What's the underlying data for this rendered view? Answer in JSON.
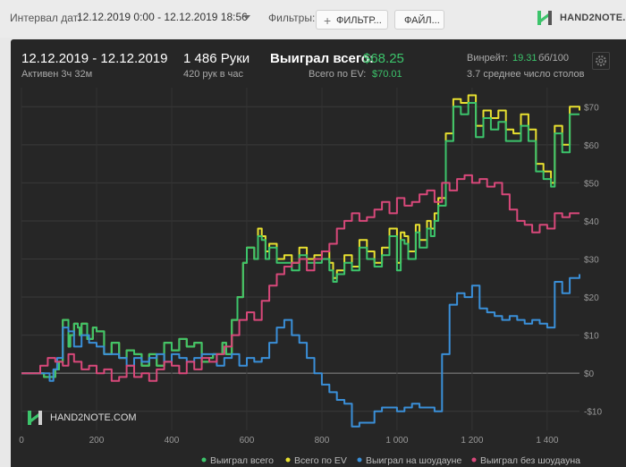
{
  "filters_bar": {
    "interval_label": "Интервал дат:",
    "date_range": "12.12.2019 0:00 - 12.12.2019 18:56",
    "filters_label": "Фильтры:",
    "filter_button": "ФИЛЬТР...",
    "file_button": "ФАЙЛ..."
  },
  "logo": {
    "text": "HAND2NOTE.COM"
  },
  "summary": {
    "date_range": "12.12.2019 - 12.12.2019",
    "active_time": "Активен 3ч 32м",
    "hands": "1 486 Руки",
    "hands_per_hour": "420 рук в час",
    "won_total_label": "Выиграл всего:",
    "won_total_value": "$68.25",
    "ev_total_label": "Всего по EV:",
    "ev_total_value": "$70.01",
    "winrate_label": "Винрейт:",
    "winrate_value": "19.31",
    "winrate_unit": "бб/100",
    "avg_tables": "3.7 среднее число столов"
  },
  "watermark": "HAND2NOTE.COM",
  "chart_data": {
    "type": "line",
    "xlim": [
      0,
      1486
    ],
    "ylim": [
      -15,
      75
    ],
    "x_ticks": [
      0,
      200,
      400,
      600,
      800,
      1000,
      1200,
      1400
    ],
    "x_tick_labels": [
      "0",
      "200",
      "400",
      "600",
      "800",
      "1 000",
      "1 200",
      "1 400"
    ],
    "y_ticks": [
      -10,
      0,
      10,
      20,
      30,
      40,
      50,
      60,
      70
    ],
    "y_tick_labels": [
      "-$10",
      "$0",
      "$10",
      "$20",
      "$30",
      "$40",
      "$50",
      "$60",
      "$70"
    ],
    "grid": true,
    "legend_position": "bottom",
    "series": [
      {
        "name": "Всего по EV",
        "color": "#e8e030",
        "x": [
          0,
          30,
          60,
          90,
          100,
          110,
          125,
          130,
          140,
          150,
          155,
          160,
          175,
          190,
          200,
          220,
          240,
          260,
          280,
          300,
          320,
          340,
          360,
          380,
          400,
          420,
          440,
          460,
          480,
          500,
          510,
          520,
          535,
          545,
          560,
          575,
          590,
          600,
          620,
          630,
          640,
          650,
          660,
          680,
          700,
          720,
          740,
          760,
          780,
          800,
          820,
          830,
          840,
          860,
          880,
          900,
          920,
          940,
          960,
          980,
          1000,
          1010,
          1020,
          1030,
          1050,
          1060,
          1080,
          1090,
          1100,
          1110,
          1130,
          1150,
          1170,
          1190,
          1210,
          1230,
          1250,
          1270,
          1290,
          1310,
          1330,
          1350,
          1370,
          1390,
          1410,
          1420,
          1440,
          1460,
          1486
        ],
        "values": [
          0,
          0,
          -1,
          1,
          3,
          14,
          7,
          10,
          13,
          12,
          10,
          13,
          9,
          12,
          11,
          5,
          8,
          4,
          6,
          5,
          2,
          5,
          2,
          8,
          6,
          9,
          7,
          8,
          3,
          4,
          5,
          5,
          8,
          5,
          14,
          20,
          29,
          33,
          30,
          38,
          36,
          32,
          34,
          30,
          31,
          29,
          33,
          30,
          31,
          32,
          29,
          25,
          27,
          31,
          28,
          35,
          32,
          29,
          33,
          38,
          29,
          37,
          36,
          32,
          39,
          35,
          40,
          38,
          42,
          46,
          63,
          72,
          71,
          73,
          65,
          69,
          67,
          69,
          64,
          63,
          68,
          64,
          55,
          53,
          50,
          65,
          60,
          70,
          69
        ]
      },
      {
        "name": "Выиграл всего",
        "color": "#3cc46b",
        "x": [
          0,
          30,
          60,
          90,
          100,
          110,
          125,
          130,
          140,
          150,
          155,
          160,
          175,
          190,
          200,
          220,
          240,
          260,
          280,
          300,
          320,
          340,
          360,
          380,
          400,
          420,
          440,
          460,
          480,
          500,
          510,
          520,
          535,
          545,
          560,
          575,
          590,
          600,
          620,
          630,
          640,
          650,
          660,
          680,
          700,
          720,
          740,
          760,
          780,
          800,
          820,
          830,
          840,
          860,
          880,
          900,
          920,
          940,
          960,
          980,
          1000,
          1010,
          1020,
          1030,
          1050,
          1060,
          1080,
          1090,
          1100,
          1110,
          1130,
          1150,
          1170,
          1190,
          1210,
          1230,
          1250,
          1270,
          1290,
          1310,
          1330,
          1350,
          1370,
          1390,
          1410,
          1420,
          1440,
          1460,
          1486
        ],
        "values": [
          0,
          0,
          -1,
          1,
          3,
          14,
          7,
          10,
          13,
          12,
          10,
          13,
          9,
          12,
          11,
          5,
          8,
          4,
          6,
          5,
          2,
          5,
          2,
          8,
          6,
          9,
          7,
          8,
          3,
          4,
          5,
          5,
          8,
          5,
          14,
          20,
          29,
          33,
          30,
          36,
          35,
          30,
          33,
          29,
          29,
          27,
          31,
          29,
          29,
          30,
          27,
          24,
          26,
          29,
          27,
          33,
          30,
          28,
          31,
          36,
          27,
          35,
          34,
          30,
          37,
          33,
          38,
          36,
          40,
          44,
          61,
          70,
          68,
          71,
          62,
          67,
          64,
          66,
          61,
          61,
          65,
          61,
          53,
          51,
          49,
          63,
          58,
          68,
          68
        ]
      },
      {
        "name": "Выиграл на шоудауне",
        "color": "#3a8fd8",
        "x": [
          0,
          75,
          85,
          95,
          110,
          125,
          140,
          160,
          180,
          200,
          220,
          240,
          260,
          280,
          300,
          320,
          340,
          360,
          380,
          400,
          420,
          440,
          460,
          480,
          500,
          520,
          540,
          560,
          580,
          600,
          620,
          640,
          660,
          680,
          700,
          720,
          740,
          760,
          780,
          800,
          820,
          840,
          860,
          880,
          900,
          920,
          940,
          960,
          980,
          1000,
          1020,
          1040,
          1060,
          1080,
          1100,
          1120,
          1140,
          1160,
          1180,
          1200,
          1220,
          1240,
          1260,
          1280,
          1300,
          1320,
          1340,
          1360,
          1380,
          1400,
          1420,
          1440,
          1460,
          1486
        ],
        "values": [
          0,
          -2,
          1,
          4,
          12,
          11,
          7,
          10,
          8,
          7,
          5,
          5,
          4,
          2,
          4,
          3,
          4,
          5,
          3,
          5,
          4,
          3,
          4,
          5,
          5,
          2,
          4,
          5,
          2,
          4,
          3,
          4,
          8,
          12,
          14,
          10,
          8,
          4,
          0,
          -3,
          -5,
          -7,
          -8,
          -14,
          -13,
          -13,
          -10,
          -9,
          -9,
          -10,
          -9,
          -8,
          -9,
          -9,
          -10,
          5,
          18,
          21,
          20,
          23,
          17,
          16,
          15,
          14,
          15,
          14,
          13,
          14,
          13,
          12,
          24,
          21,
          25,
          26
        ]
      },
      {
        "name": "Выиграл без шоудауна",
        "color": "#d8487a",
        "x": [
          0,
          50,
          70,
          90,
          110,
          125,
          140,
          160,
          180,
          200,
          220,
          240,
          260,
          280,
          300,
          320,
          340,
          360,
          380,
          400,
          420,
          440,
          460,
          480,
          500,
          520,
          540,
          560,
          580,
          600,
          620,
          640,
          660,
          680,
          700,
          720,
          740,
          760,
          780,
          800,
          820,
          840,
          860,
          880,
          900,
          920,
          940,
          960,
          980,
          1000,
          1020,
          1040,
          1060,
          1080,
          1100,
          1120,
          1140,
          1160,
          1180,
          1200,
          1220,
          1240,
          1260,
          1280,
          1300,
          1320,
          1340,
          1360,
          1380,
          1400,
          1420,
          1440,
          1460,
          1486
        ],
        "values": [
          0,
          2,
          4,
          3,
          2,
          5,
          3,
          1,
          2,
          0,
          1,
          -2,
          -1,
          2,
          -1,
          0,
          -2,
          1,
          3,
          2,
          0,
          3,
          1,
          4,
          3,
          5,
          7,
          10,
          14,
          16,
          14,
          19,
          23,
          26,
          28,
          29,
          30,
          27,
          30,
          32,
          34,
          38,
          40,
          42,
          40,
          41,
          43,
          45,
          42,
          46,
          44,
          45,
          47,
          48,
          45,
          50,
          48,
          51,
          52,
          50,
          51,
          49,
          50,
          47,
          43,
          40,
          39,
          37,
          39,
          38,
          42,
          41,
          42,
          42
        ]
      }
    ]
  }
}
